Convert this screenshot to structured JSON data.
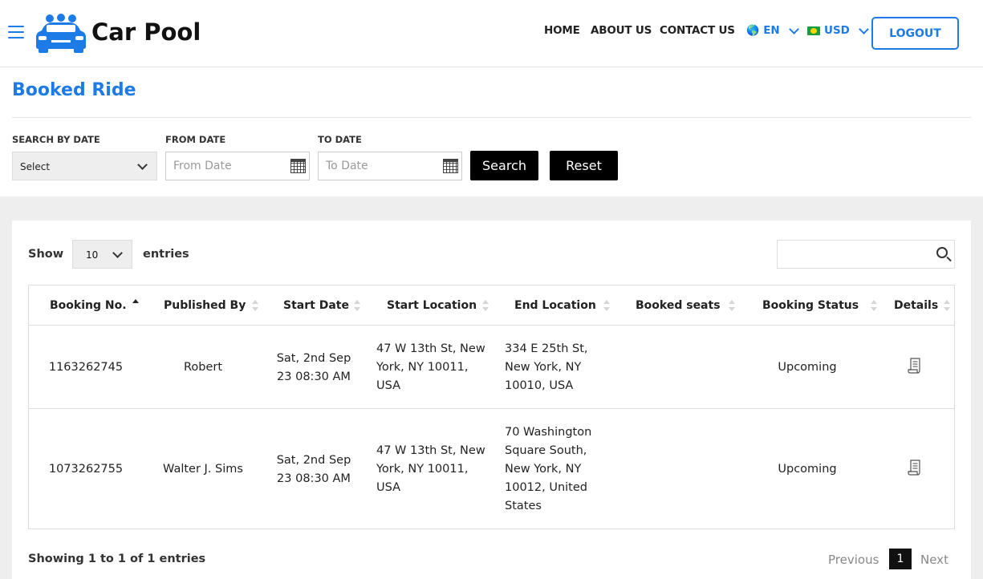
{
  "header": {
    "logo_text": "Car Pool",
    "nav": {
      "home": "HOME",
      "about": "ABOUT US",
      "contact": "CONTACT US"
    },
    "language": "EN",
    "currency": "USD",
    "logout": "LOGOUT",
    "icons": [
      "hamburger-icon",
      "car-logo-icon",
      "globe-icon",
      "flag-icon",
      "chevron-down-icon"
    ]
  },
  "page": {
    "title": "Booked Ride"
  },
  "filters": {
    "search_by_date_label": "SEARCH BY DATE",
    "search_by_date_value": "Select",
    "from_date_label": "FROM DATE",
    "from_date_placeholder": "From Date",
    "to_date_label": "TO DATE",
    "to_date_placeholder": "To Date",
    "search_button": "Search",
    "reset_button": "Reset"
  },
  "table_controls": {
    "show_label": "Show",
    "entries_value": "10",
    "entries_label": "entries",
    "search_value": ""
  },
  "table": {
    "columns": [
      "Booking No.",
      "Published By",
      "Start Date",
      "Start Location",
      "End Location",
      "Booked seats",
      "Booking Status",
      "Details"
    ],
    "rows": [
      {
        "booking_no": "1163262745",
        "published_by": "Robert",
        "start_date": [
          "Sat, 2nd Sep",
          "23 08:30 AM"
        ],
        "start_location": [
          "47 W 13th St, New",
          "York, NY 10011,",
          "USA"
        ],
        "end_location": [
          "334 E 25th St,",
          "New York, NY",
          "10010, USA"
        ],
        "booked_seats": "",
        "status": "Upcoming"
      },
      {
        "booking_no": "1073262755",
        "published_by": "Walter J. Sims",
        "start_date": [
          "Sat, 2nd Sep",
          "23 08:30 AM"
        ],
        "start_location": [
          "47 W 13th St, New",
          "York, NY 10011,",
          "USA"
        ],
        "end_location": [
          "70 Washington",
          "Square South,",
          "New York, NY",
          "10012, United",
          "States"
        ],
        "booked_seats": "",
        "status": "Upcoming"
      }
    ]
  },
  "footer": {
    "showing": "Showing 1 to 1 of 1 entries",
    "previous": "Previous",
    "current_page": "1",
    "next": "Next"
  },
  "colors": {
    "accent": "#1d7be8",
    "button_dark": "#000000",
    "band": "#eeeeee"
  }
}
